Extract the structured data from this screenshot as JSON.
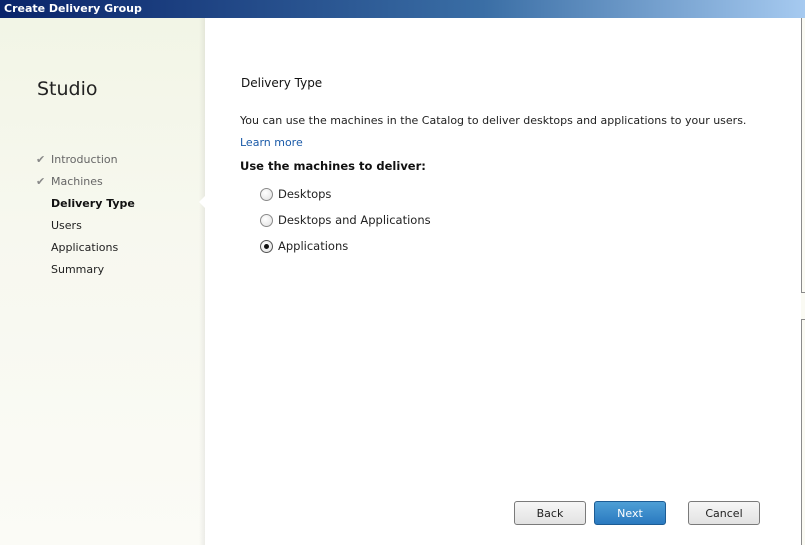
{
  "window": {
    "title": "Create Delivery Group"
  },
  "sidebar": {
    "app_title": "Studio",
    "steps": [
      {
        "label": "Introduction",
        "state": "done"
      },
      {
        "label": "Machines",
        "state": "done"
      },
      {
        "label": "Delivery Type",
        "state": "current"
      },
      {
        "label": "Users",
        "state": "pending"
      },
      {
        "label": "Applications",
        "state": "pending"
      },
      {
        "label": "Summary",
        "state": "pending"
      }
    ]
  },
  "main": {
    "heading": "Delivery Type",
    "description": "You can use the machines in the Catalog to deliver desktops and applications to your users.",
    "learn_more": "Learn more",
    "question": "Use the machines to deliver:",
    "options": [
      {
        "label": "Desktops",
        "checked": false
      },
      {
        "label": "Desktops and Applications",
        "checked": false
      },
      {
        "label": "Applications",
        "checked": true
      }
    ]
  },
  "buttons": {
    "back": "Back",
    "next": "Next",
    "cancel": "Cancel"
  },
  "colors": {
    "accent": "#2a79c0",
    "link": "#1a5aa8"
  }
}
